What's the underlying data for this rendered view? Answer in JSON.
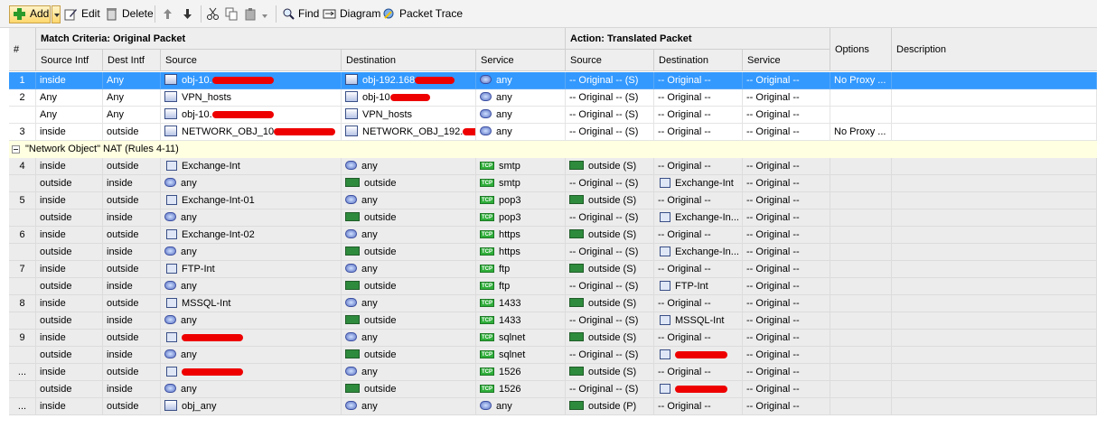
{
  "toolbar": {
    "add": "Add",
    "edit": "Edit",
    "delete": "Delete",
    "find": "Find",
    "diagram": "Diagram",
    "packet_trace": "Packet Trace"
  },
  "header": {
    "num": "#",
    "match_group": "Match Criteria: Original Packet",
    "action_group": "Action: Translated Packet",
    "options": "Options",
    "description": "Description",
    "columns": [
      "Source Intf",
      "Dest Intf",
      "Source",
      "Destination",
      "Service",
      "Source",
      "Destination",
      "Service"
    ]
  },
  "group_label": "\"Network Object\" NAT (Rules 4-11)",
  "rows": [
    {
      "num": "1",
      "src_intf": "inside",
      "dst_intf": "Any",
      "source": "obj-10.",
      "source_icon": "network-icon",
      "source_redact": true,
      "dest": "obj-192.168",
      "dest_icon": "network-icon",
      "dest_redact": true,
      "service": "any",
      "service_icon": "any-icon",
      "t_src": "-- Original -- (S)",
      "t_src_icon": "",
      "t_dst": "-- Original --",
      "t_dst_icon": "",
      "t_svc": "-- Original --",
      "options": "No Proxy ..."
    },
    {
      "num": "2",
      "src_intf": "Any",
      "dst_intf": "Any",
      "source": "VPN_hosts",
      "source_icon": "network-icon",
      "dest": "obj-10",
      "dest_icon": "network-icon",
      "dest_redact": true,
      "service": "any",
      "service_icon": "any-icon",
      "t_src": "-- Original -- (S)",
      "t_dst": "-- Original --",
      "t_svc": "-- Original --",
      "options": ""
    },
    {
      "num": "",
      "src_intf": "Any",
      "dst_intf": "Any",
      "source": "obj-10.",
      "source_icon": "network-icon",
      "source_redact": true,
      "dest": "VPN_hosts",
      "dest_icon": "network-icon",
      "service": "any",
      "service_icon": "any-icon",
      "t_src": "-- Original -- (S)",
      "t_dst": "-- Original --",
      "t_svc": "-- Original --",
      "options": ""
    },
    {
      "num": "3",
      "src_intf": "inside",
      "dst_intf": "outside",
      "source": "NETWORK_OBJ_10",
      "source_icon": "network-icon",
      "source_redact": true,
      "dest": "NETWORK_OBJ_192.",
      "dest_icon": "network-icon",
      "dest_redact": true,
      "service": "any",
      "service_icon": "any-icon",
      "t_src": "-- Original -- (S)",
      "t_dst": "-- Original --",
      "t_svc": "-- Original --",
      "options": "No Proxy ..."
    },
    {
      "num": "4",
      "src_intf": "inside",
      "dst_intf": "outside",
      "source": "Exchange-Int",
      "source_icon": "host-icon",
      "dest": "any",
      "dest_icon": "any-icon",
      "service": "smtp",
      "service_icon": "tcp-icon",
      "t_src": "outside (S)",
      "t_src_icon": "interface-icon",
      "t_dst": "-- Original --",
      "t_svc": "-- Original --",
      "options": ""
    },
    {
      "num": "",
      "src_intf": "outside",
      "dst_intf": "inside",
      "source": "any",
      "source_icon": "any-icon",
      "dest": "outside",
      "dest_icon": "interface-icon",
      "service": "smtp",
      "service_icon": "tcp-icon",
      "t_src": "-- Original -- (S)",
      "t_dst": "Exchange-Int",
      "t_dst_icon": "host-icon",
      "t_svc": "-- Original --",
      "options": ""
    },
    {
      "num": "5",
      "src_intf": "inside",
      "dst_intf": "outside",
      "source": "Exchange-Int-01",
      "source_icon": "host-icon",
      "dest": "any",
      "dest_icon": "any-icon",
      "service": "pop3",
      "service_icon": "tcp-icon",
      "t_src": "outside (S)",
      "t_src_icon": "interface-icon",
      "t_dst": "-- Original --",
      "t_svc": "-- Original --",
      "options": ""
    },
    {
      "num": "",
      "src_intf": "outside",
      "dst_intf": "inside",
      "source": "any",
      "source_icon": "any-icon",
      "dest": "outside",
      "dest_icon": "interface-icon",
      "service": "pop3",
      "service_icon": "tcp-icon",
      "t_src": "-- Original -- (S)",
      "t_dst": "Exchange-In...",
      "t_dst_icon": "host-icon",
      "t_svc": "-- Original --",
      "options": ""
    },
    {
      "num": "6",
      "src_intf": "inside",
      "dst_intf": "outside",
      "source": "Exchange-Int-02",
      "source_icon": "host-icon",
      "dest": "any",
      "dest_icon": "any-icon",
      "service": "https",
      "service_icon": "tcp-icon",
      "t_src": "outside (S)",
      "t_src_icon": "interface-icon",
      "t_dst": "-- Original --",
      "t_svc": "-- Original --",
      "options": ""
    },
    {
      "num": "",
      "src_intf": "outside",
      "dst_intf": "inside",
      "source": "any",
      "source_icon": "any-icon",
      "dest": "outside",
      "dest_icon": "interface-icon",
      "service": "https",
      "service_icon": "tcp-icon",
      "t_src": "-- Original -- (S)",
      "t_dst": "Exchange-In...",
      "t_dst_icon": "host-icon",
      "t_svc": "-- Original --",
      "options": ""
    },
    {
      "num": "7",
      "src_intf": "inside",
      "dst_intf": "outside",
      "source": "FTP-Int",
      "source_icon": "host-icon",
      "dest": "any",
      "dest_icon": "any-icon",
      "service": "ftp",
      "service_icon": "tcp-icon",
      "t_src": "outside (S)",
      "t_src_icon": "interface-icon",
      "t_dst": "-- Original --",
      "t_svc": "-- Original --",
      "options": ""
    },
    {
      "num": "",
      "src_intf": "outside",
      "dst_intf": "inside",
      "source": "any",
      "source_icon": "any-icon",
      "dest": "outside",
      "dest_icon": "interface-icon",
      "service": "ftp",
      "service_icon": "tcp-icon",
      "t_src": "-- Original -- (S)",
      "t_dst": "FTP-Int",
      "t_dst_icon": "host-icon",
      "t_svc": "-- Original --",
      "options": ""
    },
    {
      "num": "8",
      "src_intf": "inside",
      "dst_intf": "outside",
      "source": "MSSQL-Int",
      "source_icon": "host-icon",
      "dest": "any",
      "dest_icon": "any-icon",
      "service": "1433",
      "service_icon": "tcp-icon",
      "t_src": "outside (S)",
      "t_src_icon": "interface-icon",
      "t_dst": "-- Original --",
      "t_svc": "-- Original --",
      "options": ""
    },
    {
      "num": "",
      "src_intf": "outside",
      "dst_intf": "inside",
      "source": "any",
      "source_icon": "any-icon",
      "dest": "outside",
      "dest_icon": "interface-icon",
      "service": "1433",
      "service_icon": "tcp-icon",
      "t_src": "-- Original -- (S)",
      "t_dst": "MSSQL-Int",
      "t_dst_icon": "host-icon",
      "t_svc": "-- Original --",
      "options": ""
    },
    {
      "num": "9",
      "src_intf": "inside",
      "dst_intf": "outside",
      "source": "",
      "source_icon": "host-icon",
      "source_redact": true,
      "dest": "any",
      "dest_icon": "any-icon",
      "service": "sqlnet",
      "service_icon": "tcp-icon",
      "t_src": "outside (S)",
      "t_src_icon": "interface-icon",
      "t_dst": "-- Original --",
      "t_svc": "-- Original --",
      "options": ""
    },
    {
      "num": "",
      "src_intf": "outside",
      "dst_intf": "inside",
      "source": "any",
      "source_icon": "any-icon",
      "dest": "outside",
      "dest_icon": "interface-icon",
      "service": "sqlnet",
      "service_icon": "tcp-icon",
      "t_src": "-- Original -- (S)",
      "t_dst": "",
      "t_dst_icon": "host-icon",
      "t_dst_redact": true,
      "t_svc": "-- Original --",
      "options": ""
    },
    {
      "num": "...",
      "src_intf": "inside",
      "dst_intf": "outside",
      "source": "",
      "source_icon": "host-icon",
      "source_redact": true,
      "dest": "any",
      "dest_icon": "any-icon",
      "service": "1526",
      "service_icon": "tcp-icon",
      "t_src": "outside (S)",
      "t_src_icon": "interface-icon",
      "t_dst": "-- Original --",
      "t_svc": "-- Original --",
      "options": ""
    },
    {
      "num": "",
      "src_intf": "outside",
      "dst_intf": "inside",
      "source": "any",
      "source_icon": "any-icon",
      "dest": "outside",
      "dest_icon": "interface-icon",
      "service": "1526",
      "service_icon": "tcp-icon",
      "t_src": "-- Original -- (S)",
      "t_dst": "",
      "t_dst_icon": "host-icon",
      "t_dst_redact": true,
      "t_svc": "-- Original --",
      "options": ""
    },
    {
      "num": "...",
      "src_intf": "inside",
      "dst_intf": "outside",
      "source": "obj_any",
      "source_icon": "network-icon",
      "dest": "any",
      "dest_icon": "any-icon",
      "service": "any",
      "service_icon": "any-icon",
      "t_src": "outside (P)",
      "t_src_icon": "interface-icon",
      "t_dst": "-- Original --",
      "t_svc": "-- Original --",
      "options": ""
    }
  ],
  "selected_row": 0
}
